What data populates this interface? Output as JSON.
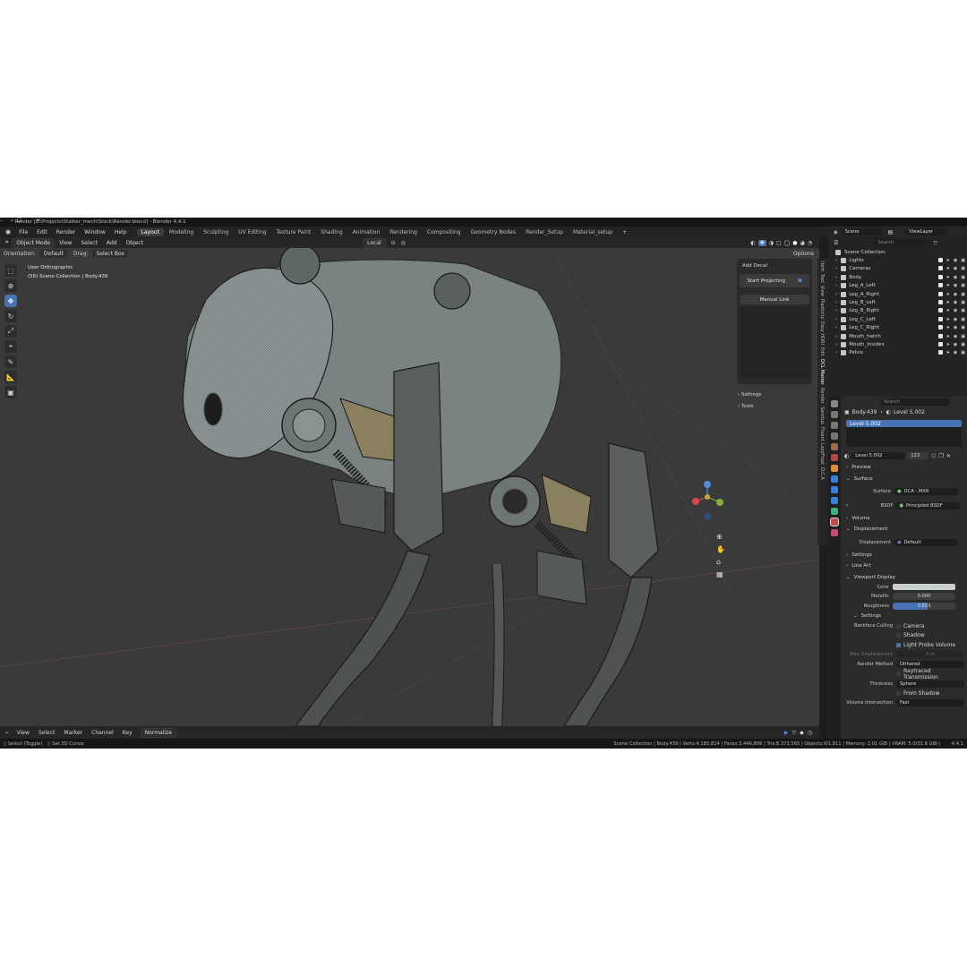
{
  "window": {
    "title": "* Render [E:\\Projects\\Stalker_mech\\Stock\\Render.blend] - Blender 4.4.1",
    "buttons": [
      "–",
      "☐",
      "✕"
    ]
  },
  "menubar": {
    "items": [
      "File",
      "Edit",
      "Render",
      "Window",
      "Help"
    ],
    "workspaces": [
      "Layout",
      "Modeling",
      "Sculpting",
      "UV Editing",
      "Texture Paint",
      "Shading",
      "Animation",
      "Rendering",
      "Compositing",
      "Geometry Nodes",
      "Render_Setup",
      "Material_setup"
    ],
    "active_workspace": "Layout",
    "add_tab": "+"
  },
  "viewport_header": {
    "mode": "Object Mode",
    "menus": [
      "View",
      "Select",
      "Add",
      "Object"
    ],
    "transform": "Local",
    "orientation_label": "Orientation:",
    "orientation": "Default",
    "drag_label": "Drag:",
    "drag": "Select Box",
    "options": "Options"
  },
  "viewport": {
    "view_name": "User Orthographic",
    "collection_info": "(56) Scene Collection | Body.439",
    "background": "#3a3a3a"
  },
  "npanel": {
    "add_decal": "Add Decal",
    "start_projecting": "Start Projecting",
    "manual_link": "Manual Link",
    "settings": "Settings",
    "tools": "Tools",
    "tabs": [
      "Item",
      "Tool",
      "View",
      "Plasticity",
      "Easy HDRI",
      "Edit",
      "DCL Master",
      "Render",
      "Sanctus",
      "Fluent",
      "LazyFloat",
      "O.C.A"
    ],
    "active_tab": "DCL Master"
  },
  "timeline": {
    "menus": [
      "View",
      "Select",
      "Marker",
      "Channel",
      "Key"
    ],
    "normalize": "Normalize"
  },
  "statusbar": {
    "left1": "Select (Toggle)",
    "left2": "Set 3D Cursor",
    "stats": "Scene Collection | Body.439 | Verts:4,185,814 | Faces:3,446,806 | Tris:8,373,565 | Objects:0/1,811 | Memory: 2.01 GiB | VRAM: 5.0/31.8 GiB |",
    "version": "4.4.1"
  },
  "outliner": {
    "scene": "Scene",
    "view_layer": "ViewLayer",
    "search_placeholder": "Search",
    "root": "Scene Collection",
    "items": [
      "Lights",
      "Cameras",
      "Body",
      "Leg_A_Left",
      "Leg_A_Right",
      "Leg_B_Left",
      "Leg_B_Right",
      "Leg_C_Left",
      "Leg_C_Right",
      "Mouth_hatch",
      "Mouth_Insides",
      "Pelvis"
    ]
  },
  "properties": {
    "search_placeholder": "Search",
    "object": "Body.439",
    "material": "Level 5.002",
    "slot": "Level 5.002",
    "users": "123",
    "sections": {
      "preview": "Preview",
      "surface": "Surface",
      "surface_label": "Surface",
      "surface_value": "OCA - MXR",
      "bsdf_label": "BSDF",
      "bsdf_value": "Principled BSDF",
      "volume": "Volume",
      "displacement": "Displacement",
      "displacement_label": "Displacement",
      "displacement_value": "Default",
      "settings": "Settings",
      "line_art": "Line Art",
      "viewport_display": "Viewport Display",
      "color_label": "Color",
      "metallic_label": "Metallic",
      "metallic_value": "0.000",
      "roughness_label": "Roughness",
      "roughness_value": "0.553",
      "roughness_fraction": 0.553,
      "vd_settings": "Settings",
      "backface_label": "Backface Culling",
      "camera": "Camera",
      "shadow": "Shadow",
      "light_probe": "Light Probe Volume",
      "max_disp_label": "Max Displacement",
      "max_disp_value": "0 m",
      "render_method_label": "Render Method",
      "render_method_value": "Dithered",
      "raytraced": "Raytraced Transmission",
      "thickness_label": "Thickness",
      "thickness_value": "Sphere",
      "from_shadow": "From Shadow",
      "volume_intersection_label": "Volume Intersection",
      "volume_intersection_value": "Fast"
    }
  },
  "colors": {
    "accent": "#4772b3",
    "panel": "#2b2b2b",
    "header": "#262626"
  }
}
